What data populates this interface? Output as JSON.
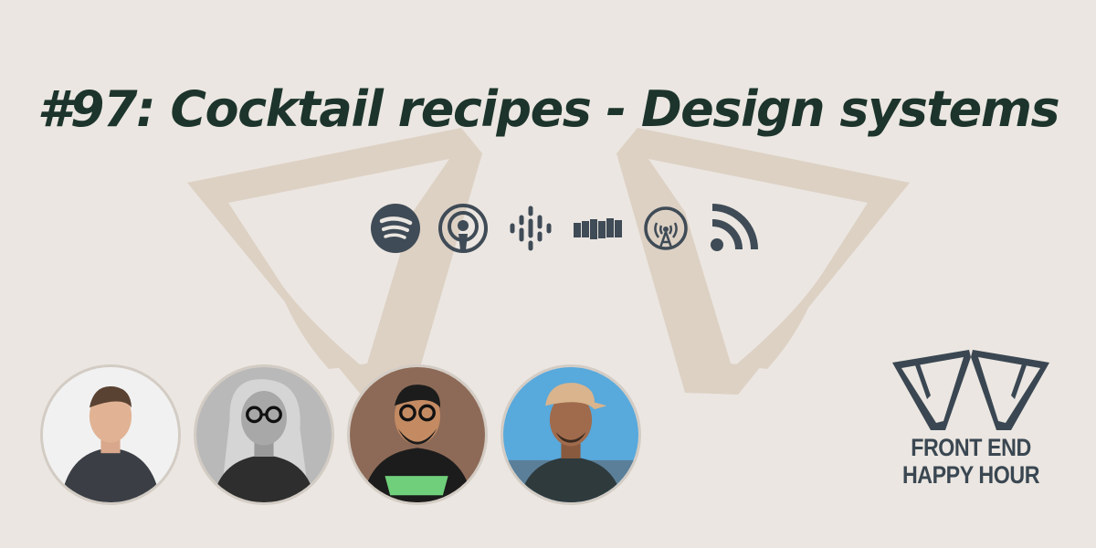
{
  "episode": {
    "title": "#97: Cocktail recipes - Design systems"
  },
  "platforms": [
    {
      "name": "Spotify",
      "icon": "spotify-icon"
    },
    {
      "name": "Apple Podcasts",
      "icon": "apple-podcasts-icon"
    },
    {
      "name": "Google Podcasts",
      "icon": "google-podcasts-icon"
    },
    {
      "name": "Stitcher",
      "icon": "stitcher-icon"
    },
    {
      "name": "Overcast",
      "icon": "overcast-icon"
    },
    {
      "name": "RSS",
      "icon": "rss-icon"
    }
  ],
  "hosts": [
    {
      "icon": "host-avatar-1",
      "background": "#f1f1f1"
    },
    {
      "icon": "host-avatar-2",
      "background": "#b9b9b9"
    },
    {
      "icon": "host-avatar-3",
      "background": "#8d6a57"
    },
    {
      "icon": "host-avatar-4",
      "background": "#58a9dc"
    }
  ],
  "brand": {
    "line1": "FRONT END",
    "line2": "HAPPY HOUR",
    "text_color": "#3a4752",
    "title_color": "#1c342c",
    "background": "#ebe6e1",
    "watermark_color": "#ddd1c4"
  }
}
